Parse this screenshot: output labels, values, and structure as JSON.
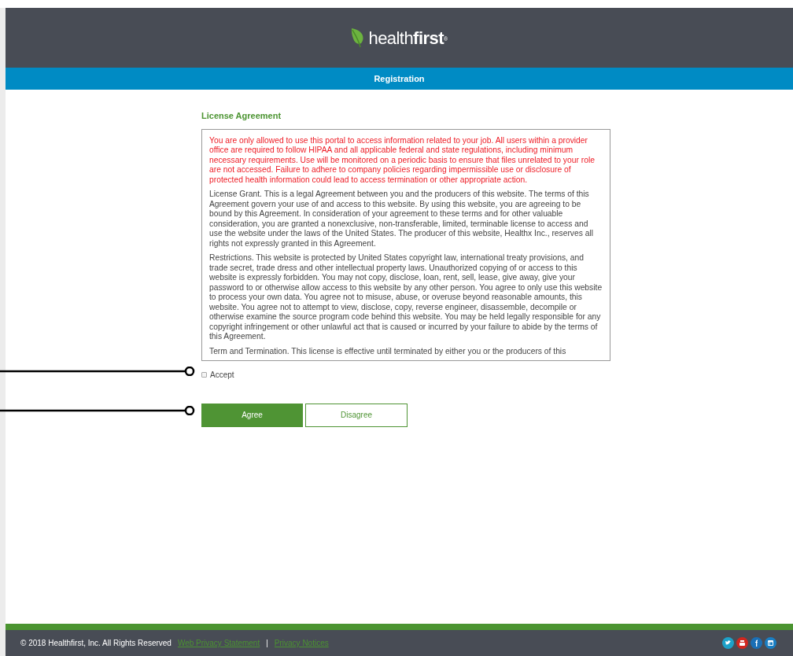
{
  "header": {
    "logo": "health**first**$^{®}$"
  },
  "banner": {
    "title": "Registration"
  },
  "license": {
    "heading": "License Agreement",
    "paragraphs": [
      {
        "kind": "warning",
        "text": "You are only allowed to use this portal to access information related to your job. All users within a provider office are required to follow HIPAA and all applicable federal and state regulations, including minimum necessary requirements. Use will be monitored on a periodic basis to ensure that files unrelated to your role are not accessed. Failure to adhere to company policies regarding impermissible use or disclosure of protected health information could lead to access termination or other appropriate action."
      },
      {
        "kind": "terms",
        "text": "License Grant. This is a legal Agreement between you and the producers of this website. The terms of this Agreement govern your use of and access to this website. By using this website, you are agreeing to be bound by this Agreement. In consideration of your agreement to these terms and for other valuable consideration, you are granted a nonexclusive, non-transferable, limited, terminable license to access and use the website under the laws of the United States. The producer of this website, Healthx Inc., reserves all rights not expressly granted in this Agreement."
      },
      {
        "kind": "terms",
        "text": "Restrictions. This website is protected by United States copyright law, international treaty provisions, and trade secret, trade dress and other intellectual property laws. Unauthorized copying of or access to this website is expressly forbidden. You may not copy, disclose, loan, rent, sell, lease, give away, give your password to or otherwise allow access to this website by any other person. You agree to only use this website to process your own data. You agree not to misuse, abuse, or overuse beyond reasonable amounts, this website. You agree not to attempt to view, disclose, copy, reverse engineer, disassemble, decompile or otherwise examine the source program code behind this website. You may be held legally responsible for any copyright infringement or other unlawful act that is caused or incurred by your failure to abide by the terms of this Agreement."
      },
      {
        "kind": "terms",
        "text": "Term and Termination. This license is effective until terminated by either you or the producers of this"
      }
    ]
  },
  "accept": {
    "label": "Accept",
    "checked": false
  },
  "buttons": [
    {
      "label": "Agree",
      "kind": "primary"
    },
    {
      "label": "Disagree",
      "kind": "secondary"
    }
  ],
  "footer": {
    "copyright": "© 2018 Healthfirst, Inc. All Rights Reserved",
    "links": [
      "Web Privacy Statement",
      "Privacy Notices"
    ],
    "separator": "|"
  }
}
